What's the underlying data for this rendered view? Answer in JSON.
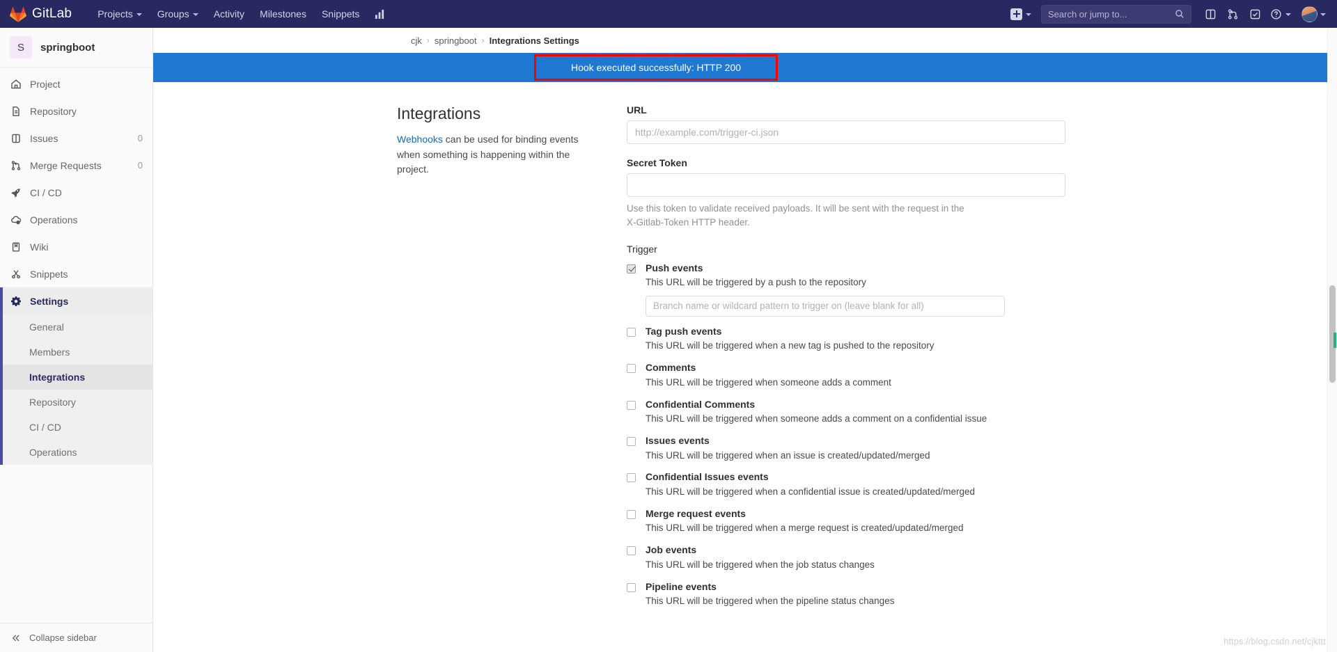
{
  "topnav": {
    "brand": "GitLab",
    "brand_icon": "gitlab-logo-icon",
    "items": [
      {
        "label": "Projects",
        "icon": "chevron-down-icon",
        "has_caret": true
      },
      {
        "label": "Groups",
        "icon": "chevron-down-icon",
        "has_caret": true
      },
      {
        "label": "Activity",
        "has_caret": false
      },
      {
        "label": "Milestones",
        "has_caret": false
      },
      {
        "label": "Snippets",
        "has_caret": false
      }
    ],
    "analytics_icon": "chart-bar-icon",
    "create_new_icon": "plus-square-icon",
    "create_new_caret": "chevron-down-icon",
    "search": {
      "placeholder": "Search or jump to...",
      "value": "",
      "icon": "search-icon"
    },
    "right_icons": [
      {
        "name": "issues-icon"
      },
      {
        "name": "merge-requests-icon"
      },
      {
        "name": "todos-icon"
      },
      {
        "name": "help-icon"
      }
    ],
    "help_caret": "chevron-down-icon",
    "avatar": "user-avatar",
    "avatar_caret": "chevron-down-icon"
  },
  "sidebar": {
    "project": {
      "initial": "S",
      "name": "springboot"
    },
    "items": [
      {
        "label": "Project",
        "icon": "home-icon",
        "badge": "",
        "active": false
      },
      {
        "label": "Repository",
        "icon": "document-icon",
        "badge": "",
        "active": false
      },
      {
        "label": "Issues",
        "icon": "issues-icon",
        "badge": "0",
        "active": false
      },
      {
        "label": "Merge Requests",
        "icon": "merge-request-icon",
        "badge": "0",
        "active": false
      },
      {
        "label": "CI / CD",
        "icon": "rocket-icon",
        "badge": "",
        "active": false
      },
      {
        "label": "Operations",
        "icon": "cloud-gear-icon",
        "badge": "",
        "active": false
      },
      {
        "label": "Wiki",
        "icon": "book-icon",
        "badge": "",
        "active": false
      },
      {
        "label": "Snippets",
        "icon": "scissors-icon",
        "badge": "",
        "active": false
      },
      {
        "label": "Settings",
        "icon": "gear-icon",
        "badge": "",
        "active": true
      }
    ],
    "sub_items": [
      {
        "label": "General",
        "active": false
      },
      {
        "label": "Members",
        "active": false
      },
      {
        "label": "Integrations",
        "active": true
      },
      {
        "label": "Repository",
        "active": false
      },
      {
        "label": "CI / CD",
        "active": false
      },
      {
        "label": "Operations",
        "active": false
      }
    ],
    "collapse": {
      "label": "Collapse sidebar",
      "icon": "chevron-double-left-icon"
    }
  },
  "breadcrumb": {
    "items": [
      "cjk",
      "springboot",
      "Integrations Settings"
    ],
    "separator": "›"
  },
  "alert": {
    "message": "Hook executed successfully: HTTP 200",
    "background": "#1f78d1",
    "annotation_color": "#ff0000"
  },
  "main": {
    "section_title": "Integrations",
    "desc_link": "Webhooks",
    "desc_rest": " can be used for binding events when something is happening within the project.",
    "url_field": {
      "label": "URL",
      "placeholder": "http://example.com/trigger-ci.json",
      "value": ""
    },
    "secret_field": {
      "label": "Secret Token",
      "placeholder": "",
      "value": "",
      "help": "Use this token to validate received payloads. It will be sent with the request in the X-Gitlab-Token HTTP header."
    },
    "trigger_label": "Trigger",
    "triggers": [
      {
        "title": "Push events",
        "desc": "This URL will be triggered by a push to the repository",
        "checked": true,
        "sub_input_placeholder": "Branch name or wildcard pattern to trigger on (leave blank for all)",
        "sub_input_value": ""
      },
      {
        "title": "Tag push events",
        "desc": "This URL will be triggered when a new tag is pushed to the repository",
        "checked": false
      },
      {
        "title": "Comments",
        "desc": "This URL will be triggered when someone adds a comment",
        "checked": false
      },
      {
        "title": "Confidential Comments",
        "desc": "This URL will be triggered when someone adds a comment on a confidential issue",
        "checked": false
      },
      {
        "title": "Issues events",
        "desc": "This URL will be triggered when an issue is created/updated/merged",
        "checked": false
      },
      {
        "title": "Confidential Issues events",
        "desc": "This URL will be triggered when a confidential issue is created/updated/merged",
        "checked": false
      },
      {
        "title": "Merge request events",
        "desc": "This URL will be triggered when a merge request is created/updated/merged",
        "checked": false
      },
      {
        "title": "Job events",
        "desc": "This URL will be triggered when the job status changes",
        "checked": false
      },
      {
        "title": "Pipeline events",
        "desc": "This URL will be triggered when the pipeline status changes",
        "checked": false
      }
    ]
  },
  "watermark": "https://blog.csdn.net/cjkttt"
}
